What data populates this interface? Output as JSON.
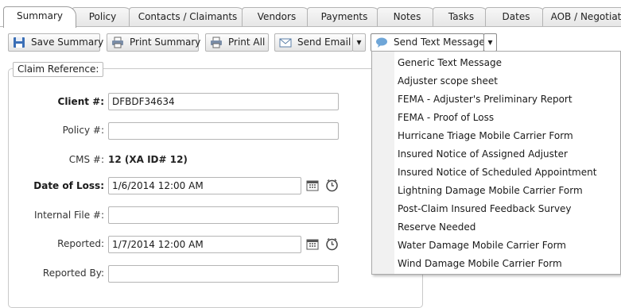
{
  "tabs": [
    {
      "label": "Summary",
      "active": true
    },
    {
      "label": "Policy"
    },
    {
      "label": "Contacts / Claimants"
    },
    {
      "label": "Vendors"
    },
    {
      "label": "Payments"
    },
    {
      "label": "Notes"
    },
    {
      "label": "Tasks"
    },
    {
      "label": "Dates"
    },
    {
      "label": "AOB / Negotiat"
    }
  ],
  "toolbar": {
    "save_summary": "Save Summary",
    "print_summary": "Print Summary",
    "print_all": "Print All",
    "send_email": "Send Email",
    "send_text": "Send Text Message"
  },
  "claim_reference": {
    "legend": "Claim Reference:",
    "client_label": "Client #:",
    "client_value": "DFBDF34634",
    "policy_label": "Policy #:",
    "policy_value": "",
    "cms_label": "CMS #:",
    "cms_value": "12 (XA ID# 12)",
    "date_of_loss_label": "Date of Loss:",
    "date_of_loss_value": "1/6/2014 12:00 AM",
    "internal_file_label": "Internal File #:",
    "internal_file_value": "",
    "reported_label": "Reported:",
    "reported_value": "1/7/2014 12:00 AM",
    "reported_by_label": "Reported By:",
    "reported_by_value": ""
  },
  "text_message_menu": [
    "Generic Text Message",
    "Adjuster scope sheet",
    "FEMA - Adjuster's Preliminary Report",
    "FEMA - Proof of Loss",
    "Hurricane Triage Mobile Carrier Form",
    "Insured Notice of Assigned Adjuster",
    "Insured Notice of Scheduled Appointment",
    "Lightning Damage Mobile Carrier Form",
    "Post-Claim Insured Feedback Survey",
    "Reserve Needed",
    "Water Damage Mobile Carrier Form",
    "Wind Damage Mobile Carrier Form"
  ]
}
